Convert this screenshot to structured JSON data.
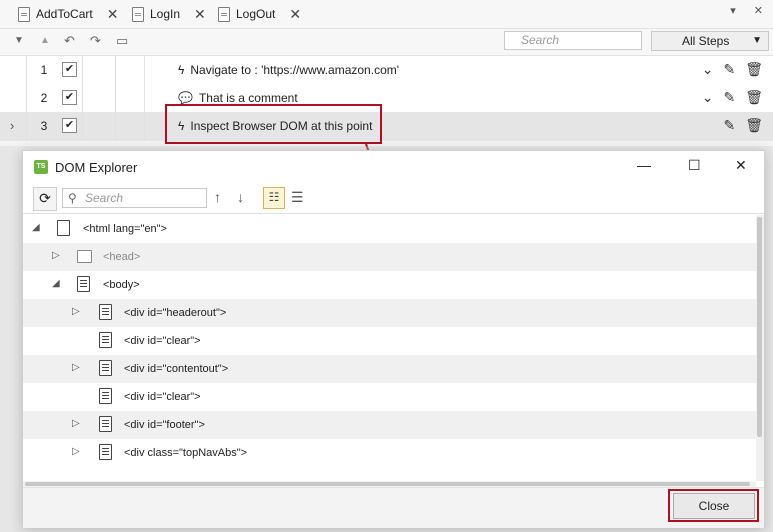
{
  "tabs": [
    {
      "label": "AddToCart"
    },
    {
      "label": "LogIn"
    },
    {
      "label": "LogOut"
    }
  ],
  "tab_close_glyph": "✕",
  "tabbar_controls": {
    "overflow": "▾",
    "close": "✕"
  },
  "toolbar": {
    "search_placeholder": "Search",
    "filter_value": "All Steps"
  },
  "steps": [
    {
      "number": "1",
      "checked": true,
      "icon": "lightning-icon",
      "text": "Navigate to : 'https://www.amazon.com'"
    },
    {
      "number": "2",
      "checked": true,
      "icon": "comment-icon",
      "text": "That is a comment"
    },
    {
      "number": "3",
      "checked": true,
      "icon": "lightning-icon",
      "text": "Inspect Browser DOM at this point",
      "selected": true
    }
  ],
  "dialog": {
    "title": "DOM Explorer",
    "app_badge": "TS",
    "search_placeholder": "Search",
    "close_label": "Close",
    "nodes": [
      {
        "label": "<html lang=\"en\">",
        "level": 0,
        "toggle": "◢",
        "icon": "document-globe-icon"
      },
      {
        "label": "<head>",
        "level": 1,
        "toggle": "▷",
        "icon": "code-icon",
        "dim": true
      },
      {
        "label": "<body>",
        "level": 1,
        "toggle": "◢",
        "icon": "page-icon"
      },
      {
        "label": "<div id=\"headerout\">",
        "level": 2,
        "toggle": "▷",
        "icon": "element-icon"
      },
      {
        "label": "<div id=\"clear\">",
        "level": 2,
        "toggle": "",
        "icon": "element-icon"
      },
      {
        "label": "<div id=\"contentout\">",
        "level": 2,
        "toggle": "▷",
        "icon": "element-icon"
      },
      {
        "label": "<div id=\"clear\">",
        "level": 2,
        "toggle": "",
        "icon": "element-icon"
      },
      {
        "label": "<div id=\"footer\">",
        "level": 2,
        "toggle": "▷",
        "icon": "element-icon"
      },
      {
        "label": "<div class=\"topNavAbs\">",
        "level": 2,
        "toggle": "▷",
        "icon": "element-icon"
      }
    ]
  },
  "colors": {
    "highlight": "#b01020",
    "badge": "#6db33f"
  }
}
